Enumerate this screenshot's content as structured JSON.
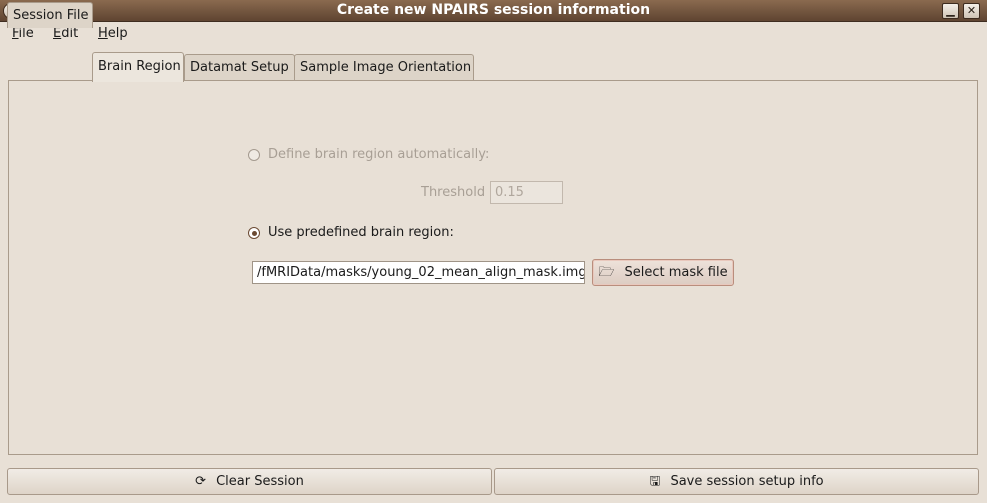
{
  "window": {
    "title": "Create new NPAIRS session information"
  },
  "menu": [
    {
      "label": "File",
      "mnemonic": "F",
      "rest": "ile"
    },
    {
      "label": "Edit",
      "mnemonic": "E",
      "rest": "dit"
    },
    {
      "label": "Help",
      "mnemonic": "H",
      "rest": "elp"
    }
  ],
  "tabs": [
    "Session File",
    "Brain Region",
    "Datamat Setup",
    "Sample Image Orientation"
  ],
  "active_tab": "Brain Region",
  "brain_region": {
    "auto_label": "Define brain region automatically:",
    "auto_selected": false,
    "auto_enabled": false,
    "threshold_label": "Threshold",
    "threshold_value": "0.15",
    "predefined_label": "Use predefined brain region:",
    "predefined_selected": true,
    "mask_path": "/fMRIData/masks/young_02_mean_align_mask.img",
    "select_mask_label": "Select mask file"
  },
  "footer": {
    "clear_label": "Clear Session",
    "save_label": "Save session setup info"
  },
  "icons": {
    "select_mask": "folder-open-icon",
    "clear": "clear-icon",
    "save": "save-icon"
  },
  "colors": {
    "titlebar": "#6f5038",
    "background": "#e8e0d6",
    "radio_accent": "#6b4a33"
  }
}
